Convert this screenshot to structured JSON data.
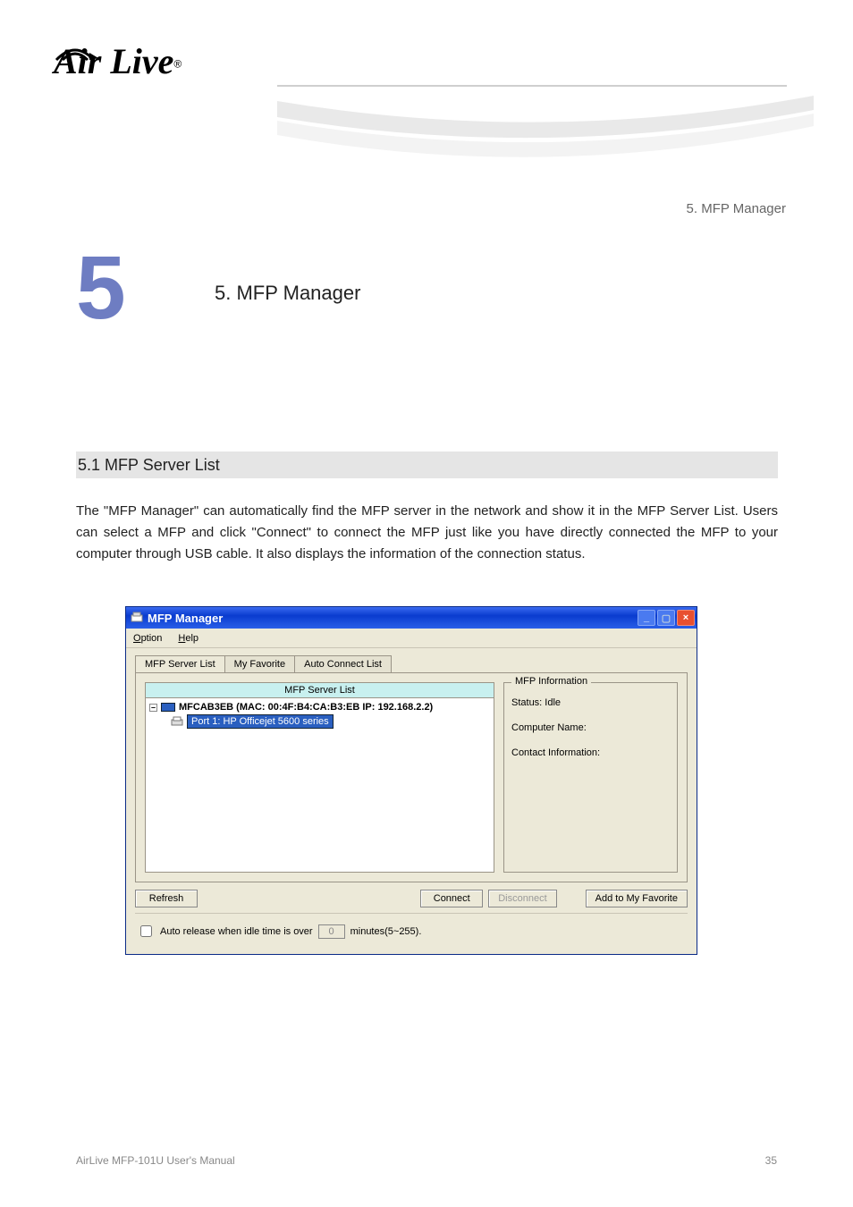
{
  "logo": {
    "brand": "Air Live"
  },
  "header_right": "5. MFP Manager",
  "chapter": {
    "num": "5",
    "label": "5. MFP Manager"
  },
  "section": {
    "title": "5.1 MFP Server List"
  },
  "body1": "The \"MFP Manager\" can automatically find the MFP server in the network and show it in the MFP Server List. Users can select a MFP and click \"Connect\" to connect the MFP just like you have directly connected the MFP to your computer through USB cable. It also displays the information of the connection status.",
  "window": {
    "title": "MFP Manager",
    "menu": {
      "option": "Option",
      "help": "Help"
    },
    "tabs": {
      "t1": "MFP Server List",
      "t2": "My Favorite",
      "t3": "Auto Connect List"
    },
    "list_header": "MFP Server List",
    "tree": {
      "server_label": "MFCAB3EB (MAC: 00:4F:B4:CA:B3:EB   IP: 192.168.2.2)",
      "port_label": "Port 1: HP Officejet 5600 series"
    },
    "info": {
      "legend": "MFP Information",
      "status_label": "Status: Idle",
      "computer_label": "Computer Name:",
      "contact_label": "Contact Information:"
    },
    "buttons": {
      "refresh": "Refresh",
      "connect": "Connect",
      "disconnect": "Disconnect",
      "addfav": "Add to My Favorite"
    },
    "auto": {
      "label1": "Auto release when idle time is over",
      "idle_value": "0",
      "label2": "minutes(5~255)."
    }
  },
  "footer": {
    "left": "AirLive MFP-101U User's Manual",
    "right": "35"
  }
}
